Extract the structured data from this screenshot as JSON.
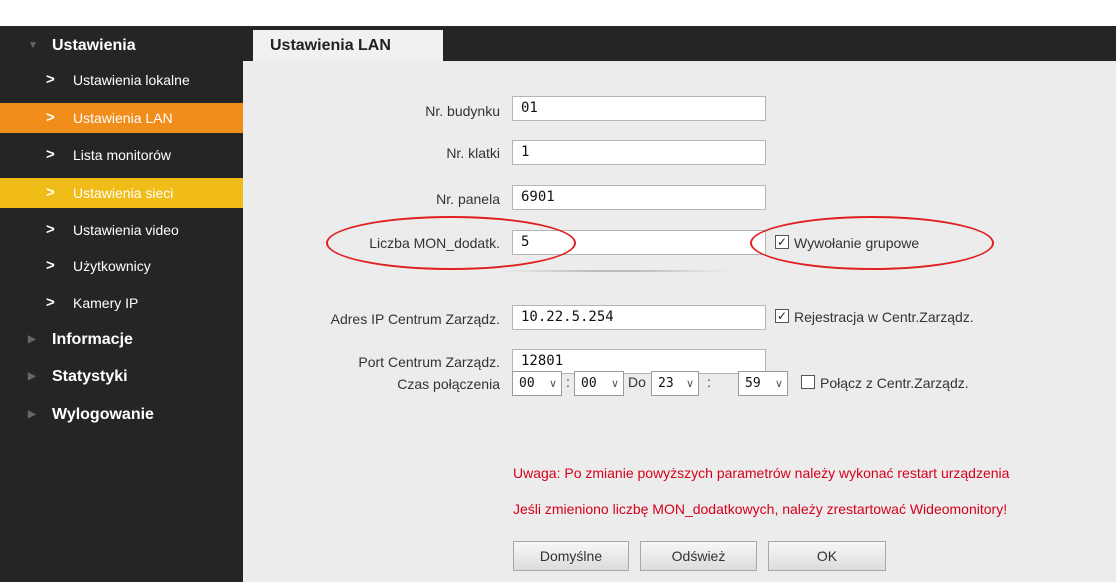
{
  "sidebar": {
    "sections": [
      {
        "label": "Ustawienia",
        "expanded": true
      },
      {
        "label": "Informacje",
        "expanded": false
      },
      {
        "label": "Statystyki",
        "expanded": false
      },
      {
        "label": "Wylogowanie",
        "expanded": false
      }
    ],
    "items": [
      {
        "label": "Ustawienia lokalne",
        "state": "normal"
      },
      {
        "label": "Ustawienia LAN",
        "state": "active"
      },
      {
        "label": "Lista monitorów",
        "state": "normal"
      },
      {
        "label": "Ustawienia sieci",
        "state": "highlight"
      },
      {
        "label": "Ustawienia video",
        "state": "normal"
      },
      {
        "label": "Użytkownicy",
        "state": "normal"
      },
      {
        "label": "Kamery IP",
        "state": "normal"
      }
    ]
  },
  "tab": {
    "title": "Ustawienia LAN"
  },
  "form": {
    "building": {
      "label": "Nr. budynku",
      "value": "01"
    },
    "stairwell": {
      "label": "Nr. klatki",
      "value": "1"
    },
    "panel": {
      "label": "Nr. panela",
      "value": "6901"
    },
    "extra_monitors": {
      "label": "Liczba MON_dodatk.",
      "value": "5"
    },
    "group_call": {
      "label": "Wywołanie grupowe",
      "checked": true
    },
    "mgmt_ip": {
      "label": "Adres IP Centrum Zarządz.",
      "value": "10.22.5.254"
    },
    "registration": {
      "label": "Rejestracja w Centr.Zarządz.",
      "checked": true
    },
    "mgmt_port": {
      "label": "Port Centrum Zarządz.",
      "value": "12801"
    },
    "conn_time": {
      "label": "Czas połączenia",
      "from_hour": "00",
      "from_min": "00",
      "to_label": "Do",
      "to_hour": "23",
      "to_min": "59",
      "separator": ":"
    },
    "connect_mgmt": {
      "label": "Połącz z Centr.Zarządz.",
      "checked": false
    }
  },
  "warnings": {
    "line1": "Uwaga: Po zmianie powyższych parametrów należy wykonać restart urządzenia",
    "line2": "Jeśli zmieniono liczbę MON_dodatkowych, należy zrestartować Wideomonitory!"
  },
  "buttons": {
    "default": "Domyślne",
    "refresh": "Odśwież",
    "ok": "OK"
  },
  "icons": {
    "checked": "✓",
    "dropdown": "∨",
    "chevron": ">",
    "triangle_down": "▼",
    "triangle_right": "▶"
  },
  "colors": {
    "sidebar": "#252525",
    "active": "#f18d1b",
    "highlight": "#f1bc17",
    "warning": "#d6001c",
    "annotation": "#e02020"
  }
}
